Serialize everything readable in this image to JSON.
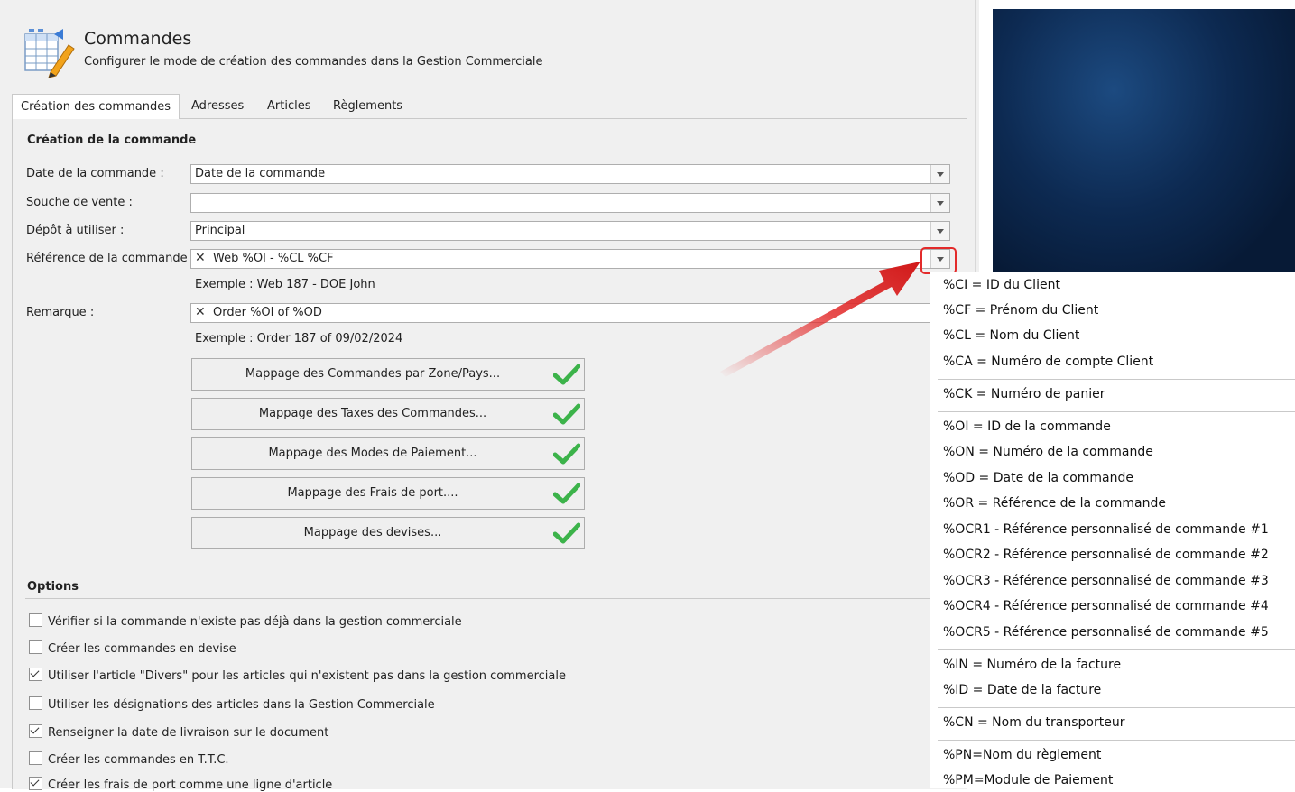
{
  "header": {
    "title": "Commandes",
    "subtitle": "Configurer le mode de création des commandes dans la Gestion Commerciale"
  },
  "tabs": [
    {
      "label": "Création des commandes",
      "active": true
    },
    {
      "label": "Adresses",
      "active": false
    },
    {
      "label": "Articles",
      "active": false
    },
    {
      "label": "Règlements",
      "active": false
    }
  ],
  "creation": {
    "section_title": "Création de la commande",
    "fields": {
      "date": {
        "label": "Date de la commande :",
        "value": "Date de la commande"
      },
      "souche": {
        "label": "Souche de vente :",
        "value": ""
      },
      "depot": {
        "label": "Dépôt à utiliser :",
        "value": "Principal"
      },
      "reference": {
        "label": "Référence de la commande :",
        "value": "Web %OI - %CL  %CF",
        "example": "Exemple : Web 187 - DOE  John"
      },
      "remarque": {
        "label": "Remarque :",
        "value": "Order %OI of %OD",
        "example": "Exemple : Order 187 of 09/02/2024"
      }
    },
    "mapping_buttons": [
      "Mappage des Commandes par Zone/Pays...",
      "Mappage des Taxes des Commandes...",
      "Mappage des Modes de Paiement...",
      "Mappage des Frais de port....",
      "Mappage des devises..."
    ]
  },
  "options": {
    "section_title": "Options",
    "items": [
      {
        "label": "Vérifier si la commande n'existe pas déjà dans la gestion commerciale",
        "checked": false
      },
      {
        "label": "Créer les commandes en devise",
        "checked": false
      },
      {
        "label": "Utiliser l'article \"Divers\" pour les articles qui n'existent pas dans la gestion commerciale",
        "checked": true
      },
      {
        "label": "Utiliser les désignations des articles dans la Gestion Commerciale",
        "checked": false
      },
      {
        "label": "Renseigner la date de livraison sur le document",
        "checked": true
      },
      {
        "label": "Créer les commandes en T.T.C.",
        "checked": false
      },
      {
        "label": "Créer les frais de port comme une ligne d'article",
        "checked": true
      }
    ]
  },
  "dropdown": {
    "groups": [
      [
        "%CI = ID du Client",
        "%CF = Prénom du Client",
        "%CL = Nom du Client",
        "%CA = Numéro de compte Client"
      ],
      [
        "%CK = Numéro de panier"
      ],
      [
        "%OI = ID de la commande",
        "%ON = Numéro de la commande",
        "%OD = Date de la commande",
        "%OR = Référence de la commande",
        "%OCR1 - Référence personnalisé de commande #1",
        "%OCR2 - Référence personnalisé de commande #2",
        "%OCR3 - Référence personnalisé de commande #3",
        "%OCR4 - Référence personnalisé de commande #4",
        "%OCR5 - Référence personnalisé de commande #5"
      ],
      [
        "%IN = Numéro de la facture",
        "%ID = Date de la facture"
      ],
      [
        "%CN = Nom du transporteur"
      ],
      [
        "%PN=Nom du règlement",
        "%PM=Module de Paiement"
      ]
    ]
  },
  "colors": {
    "highlight": "#e32b2b",
    "check": "#3cb34a",
    "desktop": "#0d2a52"
  }
}
